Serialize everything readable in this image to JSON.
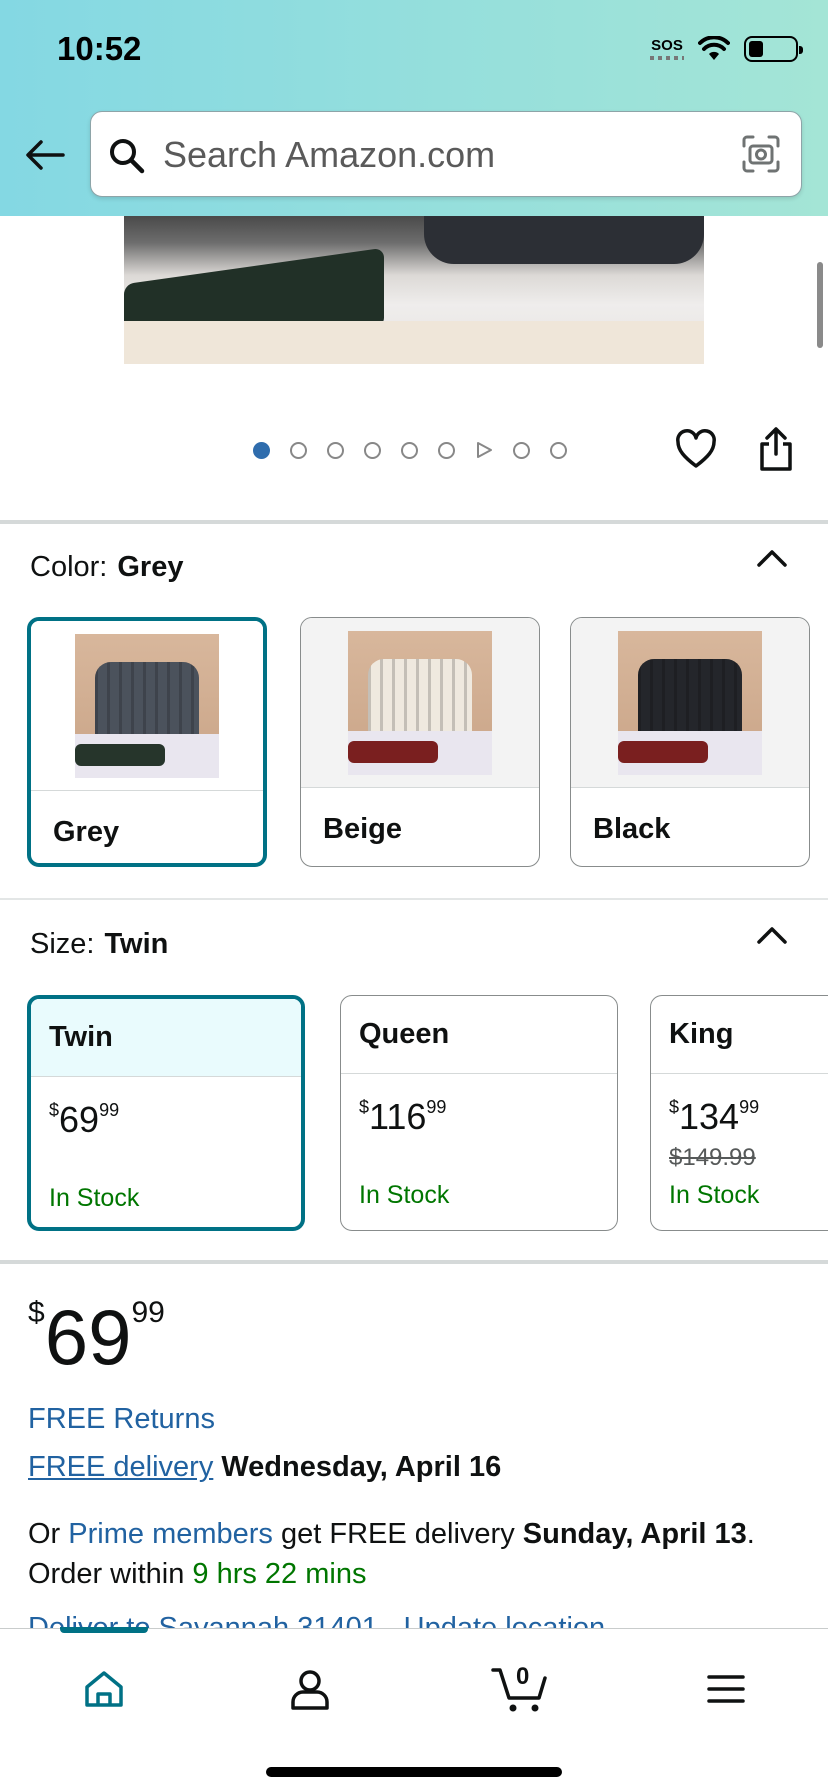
{
  "status_bar": {
    "time": "10:52",
    "sos": "SOS"
  },
  "search": {
    "placeholder": "Search Amazon.com"
  },
  "gallery": {
    "total_dots": 9,
    "active_index": 0,
    "video_index": 6
  },
  "color": {
    "label": "Color:",
    "selected": "Grey",
    "options": [
      {
        "name": "Grey",
        "selected": true,
        "cushion_color": "#4b525c",
        "throw_color": "#26352b"
      },
      {
        "name": "Beige",
        "selected": false,
        "cushion_color": "#efe9df",
        "throw_color": "#7a1f1f"
      },
      {
        "name": "Black",
        "selected": false,
        "cushion_color": "#24262b",
        "throw_color": "#7a1f1f"
      }
    ]
  },
  "size": {
    "label": "Size:",
    "selected": "Twin",
    "options": [
      {
        "name": "Twin",
        "whole": "69",
        "cents": "99",
        "list_price": "",
        "stock": "In Stock",
        "selected": true
      },
      {
        "name": "Queen",
        "whole": "116",
        "cents": "99",
        "list_price": "",
        "stock": "In Stock",
        "selected": false
      },
      {
        "name": "King",
        "whole": "134",
        "cents": "99",
        "list_price": "$149.99",
        "stock": "In Stock",
        "selected": false
      }
    ]
  },
  "price": {
    "currency": "$",
    "whole": "69",
    "cents": "99"
  },
  "returns": {
    "text": "FREE Returns"
  },
  "delivery": {
    "link": "FREE delivery",
    "date": "Wednesday, April 16"
  },
  "prime": {
    "prefix": "Or ",
    "link": "Prime members",
    "middle": " get FREE delivery ",
    "date": "Sunday, April 13",
    "period": ".",
    "order_prefix": "Order within ",
    "countdown": "9 hrs 22 mins"
  },
  "deliver_to": {
    "text": "Deliver to Savannah 31401 - Update location"
  },
  "bottom_nav": {
    "cart_count": "0"
  },
  "colors": {
    "teal": "#007185",
    "link": "#2162a1",
    "green": "#007600"
  }
}
